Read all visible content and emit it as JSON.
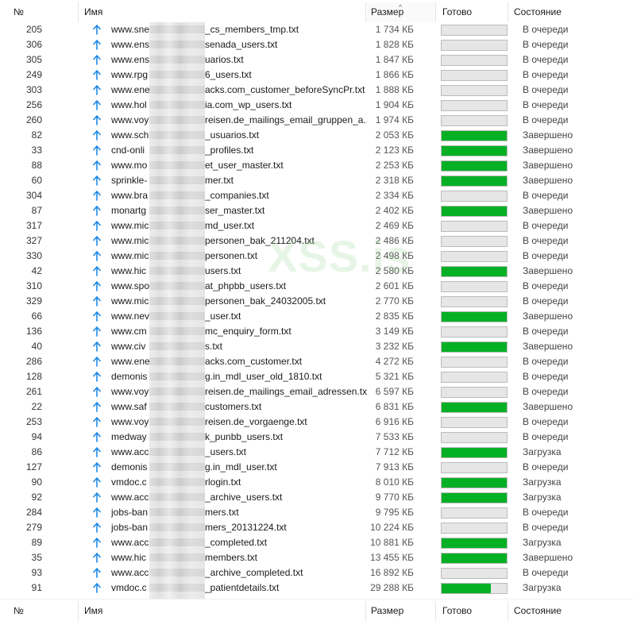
{
  "columns": {
    "num": "№",
    "name": "Имя",
    "size": "Размер",
    "done": "Готово",
    "state": "Состояние"
  },
  "sort_indicator": "^",
  "colors": {
    "progress_fill": "#06b025",
    "progress_track": "#e6e6e6",
    "upload_arrow": "#1e88e5"
  },
  "watermark": "XSS.is",
  "rows": [
    {
      "num": "205",
      "name": "www.sne",
      "name_tail": "_cs_members_tmp.txt",
      "size": "1 734 КБ",
      "progress": 0,
      "state": "В очереди"
    },
    {
      "num": "306",
      "name": "www.ens",
      "name_tail": "senada_users.txt",
      "size": "1 828 КБ",
      "progress": 0,
      "state": "В очереди"
    },
    {
      "num": "305",
      "name": "www.ens",
      "name_tail": "uarios.txt",
      "size": "1 847 КБ",
      "progress": 0,
      "state": "В очереди"
    },
    {
      "num": "249",
      "name": "www.rpg",
      "name_tail": "6_users.txt",
      "size": "1 866 КБ",
      "progress": 0,
      "state": "В очереди"
    },
    {
      "num": "303",
      "name": "www.ene",
      "name_tail": "acks.com_customer_beforeSyncPr.txt",
      "size": "1 888 КБ",
      "progress": 0,
      "state": "В очереди"
    },
    {
      "num": "256",
      "name": "www.hol",
      "name_tail": "ia.com_wp_users.txt",
      "size": "1 904 КБ",
      "progress": 0,
      "state": "В очереди"
    },
    {
      "num": "260",
      "name": "www.voy",
      "name_tail": "reisen.de_mailings_email_gruppen_a...",
      "size": "1 974 КБ",
      "progress": 0,
      "state": "В очереди"
    },
    {
      "num": "82",
      "name": "www.sch",
      "name_tail": "_usuarios.txt",
      "size": "2 053 КБ",
      "progress": 100,
      "state": "Завершено"
    },
    {
      "num": "33",
      "name": "cnd-onli",
      "name_tail": "_profiles.txt",
      "size": "2 123 КБ",
      "progress": 100,
      "state": "Завершено"
    },
    {
      "num": "88",
      "name": "www.mo",
      "name_tail": "et_user_master.txt",
      "size": "2 253 КБ",
      "progress": 100,
      "state": "Завершено"
    },
    {
      "num": "60",
      "name": "sprinkle-",
      "name_tail": "mer.txt",
      "size": "2 318 КБ",
      "progress": 100,
      "state": "Завершено"
    },
    {
      "num": "304",
      "name": "www.bra",
      "name_tail": "_companies.txt",
      "size": "2 334 КБ",
      "progress": 0,
      "state": "В очереди"
    },
    {
      "num": "87",
      "name": "monartg",
      "name_tail": "ser_master.txt",
      "size": "2 402 КБ",
      "progress": 100,
      "state": "Завершено"
    },
    {
      "num": "317",
      "name": "www.mic",
      "name_tail": "md_user.txt",
      "size": "2 469 КБ",
      "progress": 0,
      "state": "В очереди"
    },
    {
      "num": "327",
      "name": "www.mic",
      "name_tail": "personen_bak_211204.txt",
      "size": "2 486 КБ",
      "progress": 0,
      "state": "В очереди"
    },
    {
      "num": "330",
      "name": "www.mic",
      "name_tail": "personen.txt",
      "size": "2 498 КБ",
      "progress": 0,
      "state": "В очереди"
    },
    {
      "num": "42",
      "name": "www.hic",
      "name_tail": "users.txt",
      "size": "2 580 КБ",
      "progress": 100,
      "state": "Завершено"
    },
    {
      "num": "310",
      "name": "www.spo",
      "name_tail": "at_phpbb_users.txt",
      "size": "2 601 КБ",
      "progress": 0,
      "state": "В очереди"
    },
    {
      "num": "329",
      "name": "www.mic",
      "name_tail": "personen_bak_24032005.txt",
      "size": "2 770 КБ",
      "progress": 0,
      "state": "В очереди"
    },
    {
      "num": "66",
      "name": "www.nev",
      "name_tail": "_user.txt",
      "size": "2 835 КБ",
      "progress": 100,
      "state": "Завершено"
    },
    {
      "num": "136",
      "name": "www.cm",
      "name_tail": "mc_enquiry_form.txt",
      "size": "3 149 КБ",
      "progress": 0,
      "state": "В очереди"
    },
    {
      "num": "40",
      "name": "www.civ",
      "name_tail": "s.txt",
      "size": "3 232 КБ",
      "progress": 100,
      "state": "Завершено"
    },
    {
      "num": "286",
      "name": "www.ene",
      "name_tail": "acks.com_customer.txt",
      "size": "4 272 КБ",
      "progress": 0,
      "state": "В очереди"
    },
    {
      "num": "128",
      "name": "demonis",
      "name_tail": "g.in_mdl_user_old_1810.txt",
      "size": "5 321 КБ",
      "progress": 0,
      "state": "В очереди"
    },
    {
      "num": "261",
      "name": "www.voy",
      "name_tail": "reisen.de_mailings_email_adressen.txt",
      "size": "6 597 КБ",
      "progress": 0,
      "state": "В очереди"
    },
    {
      "num": "22",
      "name": "www.saf",
      "name_tail": "customers.txt",
      "size": "6 831 КБ",
      "progress": 100,
      "state": "Завершено"
    },
    {
      "num": "253",
      "name": "www.voy",
      "name_tail": "reisen.de_vorgaenge.txt",
      "size": "6 916 КБ",
      "progress": 0,
      "state": "В очереди"
    },
    {
      "num": "94",
      "name": "medway",
      "name_tail": "k_punbb_users.txt",
      "size": "7 533 КБ",
      "progress": 0,
      "state": "В очереди"
    },
    {
      "num": "86",
      "name": "www.acc",
      "name_tail": "_users.txt",
      "size": "7 712 КБ",
      "progress": 100,
      "state": "Загрузка"
    },
    {
      "num": "127",
      "name": "demonis",
      "name_tail": "g.in_mdl_user.txt",
      "size": "7 913 КБ",
      "progress": 0,
      "state": "В очереди"
    },
    {
      "num": "90",
      "name": "vmdoc.c",
      "name_tail": "rlogin.txt",
      "size": "8 010 КБ",
      "progress": 100,
      "state": "Загрузка"
    },
    {
      "num": "92",
      "name": "www.acc",
      "name_tail": "_archive_users.txt",
      "size": "9 770 КБ",
      "progress": 100,
      "state": "Загрузка"
    },
    {
      "num": "284",
      "name": "jobs-ban",
      "name_tail": "mers.txt",
      "size": "9 795 КБ",
      "progress": 0,
      "state": "В очереди"
    },
    {
      "num": "279",
      "name": "jobs-ban",
      "name_tail": "mers_20131224.txt",
      "size": "10 224 КБ",
      "progress": 0,
      "state": "В очереди"
    },
    {
      "num": "89",
      "name": "www.acc",
      "name_tail": "_completed.txt",
      "size": "10 881 КБ",
      "progress": 100,
      "state": "Загрузка"
    },
    {
      "num": "35",
      "name": "www.hic",
      "name_tail": "members.txt",
      "size": "13 455 КБ",
      "progress": 100,
      "state": "Завершено"
    },
    {
      "num": "93",
      "name": "www.acc",
      "name_tail": "_archive_completed.txt",
      "size": "16 892 КБ",
      "progress": 0,
      "state": "В очереди"
    },
    {
      "num": "91",
      "name": "vmdoc.c",
      "name_tail": "_patientdetails.txt",
      "size": "29 288 КБ",
      "progress": 76,
      "state": "Загрузка"
    }
  ]
}
